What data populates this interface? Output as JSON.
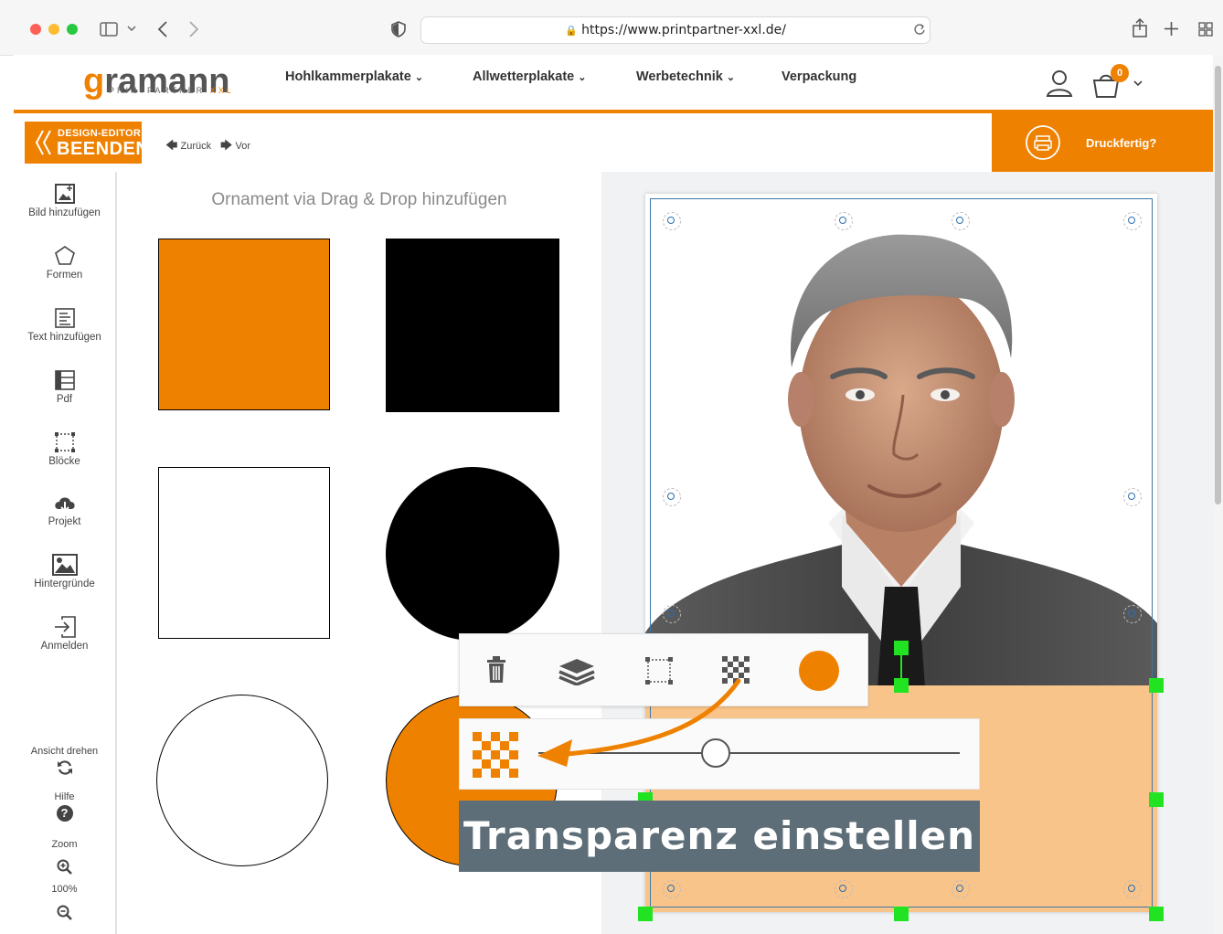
{
  "browser": {
    "url": "https://www.printpartner-xxl.de/"
  },
  "site": {
    "logo_word": "ramann",
    "logo_g": "g",
    "logo_sub": "PRINTPARTNER",
    "logo_xxl": "XXL",
    "nav": [
      "Hohlkammerplakate",
      "Allwetterplakate",
      "Werbetechnik",
      "Verpackung"
    ],
    "cart_count": "0"
  },
  "editor": {
    "exit_top": "DESIGN-EDITOR",
    "exit_bottom": "BEENDEN",
    "back_label": "Zurück",
    "forward_label": "Vor",
    "print_ready_label": "Druckfertig?"
  },
  "sidebar": {
    "items": [
      {
        "label": "Bild hinzufügen",
        "icon": "add-image-icon"
      },
      {
        "label": "Formen",
        "icon": "pentagon-icon"
      },
      {
        "label": "Text hinzufügen",
        "icon": "text-icon"
      },
      {
        "label": "Pdf",
        "icon": "pdf-icon"
      },
      {
        "label": "Blöcke",
        "icon": "blocks-icon"
      },
      {
        "label": "Projekt",
        "icon": "cloud-download-icon"
      },
      {
        "label": "Hintergründe",
        "icon": "background-image-icon"
      },
      {
        "label": "Anmelden",
        "icon": "login-icon"
      }
    ],
    "rotate_label": "Ansicht drehen",
    "help_label": "Hilfe",
    "zoom_label": "Zoom",
    "zoom_value": "100%"
  },
  "panel": {
    "title": "Ornament via Drag & Drop hinzufügen"
  },
  "colors": {
    "brand_orange": "#ef8100",
    "light_orange": "#f9c48a",
    "banner_bg": "#5e6e78",
    "handle_green": "#22e322"
  },
  "element_toolbar": {
    "tools": [
      "trash-icon",
      "layers-icon",
      "crop-icon",
      "transparency-icon",
      "color-swatch"
    ],
    "swatch_color": "#ef8100"
  },
  "transparency": {
    "slider_value": 0.42
  },
  "banner": {
    "text": "Transparenz einstellen"
  }
}
